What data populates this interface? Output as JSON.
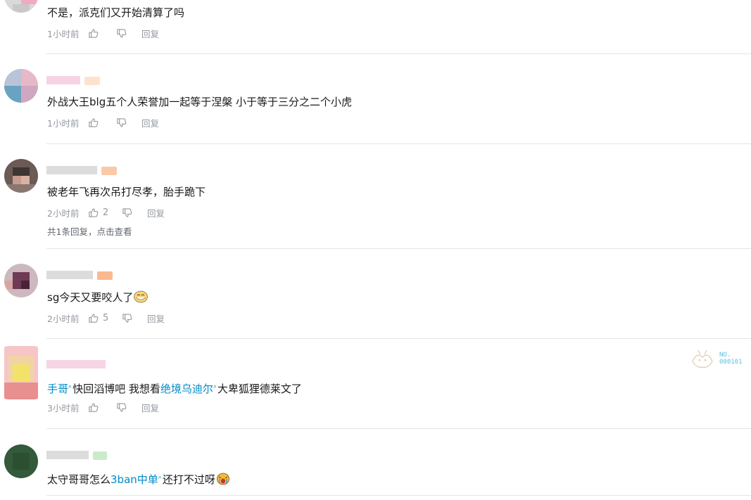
{
  "comments": [
    {
      "content": "不是，派克们又开始清算了吗",
      "time": "1小时前",
      "like_count": "",
      "reply_label": "回复"
    },
    {
      "content": "外战大王blg五个人荣誉加一起等于涅槃 小于等于三分之二个小虎",
      "time": "1小时前",
      "like_count": "",
      "reply_label": "回复"
    },
    {
      "content": "被老年飞再次吊打尽孝，胎手跪下",
      "time": "2小时前",
      "like_count": "2",
      "reply_label": "回复",
      "sub_reply": "共1条回复，点击查看"
    },
    {
      "content": "sg今天又要咬人了",
      "time": "2小时前",
      "like_count": "5",
      "reply_label": "回复",
      "emoji": "laughing-face-emoji"
    },
    {
      "content_link1": "手哥",
      "content_mid": "快回滔博吧 我想看",
      "content_link2": "绝境乌迪尔",
      "content_tail": "大卑狐狸德莱文了",
      "time": "3小时前",
      "like_count": "",
      "reply_label": "回复",
      "fan_badge": "NO.\n000101"
    },
    {
      "content_prefix": "太守哥哥怎么",
      "content_link": "3ban中单",
      "content_tail": "还打不过呀",
      "time": "",
      "emoji": "crying-face-emoji"
    }
  ],
  "fan_badge": {
    "line1": "NO.",
    "line2": "000101"
  },
  "colors": {
    "link": "#008ac5",
    "meta": "#9499a0",
    "divider": "#e3e5e7"
  }
}
